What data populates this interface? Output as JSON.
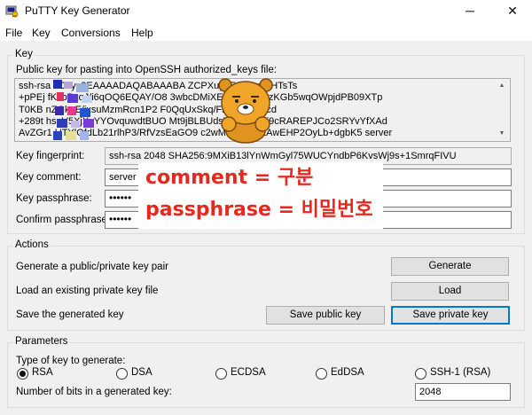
{
  "window": {
    "title": "PuTTY Key Generator",
    "minimize_glyph": "─",
    "close_glyph": "✕",
    "icon": "putty-key-icon"
  },
  "menu": [
    "File",
    "Key",
    "Conversions",
    "Help"
  ],
  "key_group": {
    "label": "Key",
    "public_key_label": "Public key for pasting into OpenSSH authorized_keys file:",
    "public_key_lines": [
      "ssh-rsa                    aC1yc2EAAAADAQABAAABA             ZCPXuyqFwU1gxLHTsTs",
      "+pPEj               fKJbPxqJ/i6qOQ6EQAY/O8                     3wbcDMiXEzNi8EClypzKGb5wqOWpjdPB09XTp",
      "T0KB               nZGkuE/jxsuMzmRcn1P2                     F0QqUxSkq/FrSatvZs8ecd",
      "+289t              hsnV5XjXxYYOvquwdtBUO                     Mt9jBLBUdsWEpEECii9cRAREPJCo2SRYvYfXAd",
      "AvZGr1               UTYlOfdLb21rlhP3/RfVzsEaGO9             c2wMFxknp0/LAwEHP2OyLb+dgbK5 server"
    ],
    "fingerprint_label": "Key fingerprint:",
    "fingerprint_value": "ssh-rsa 2048 SHA256:9MXiB13lYnWmGyl75WUCYndbP6KvsWj9s+1SmrqFIVU",
    "comment_label": "Key comment:",
    "comment_value": "server",
    "passphrase_label": "Key passphrase:",
    "passphrase_value": "••••••",
    "confirm_label": "Confirm passphrase:",
    "confirm_value": "••••••"
  },
  "actions_group": {
    "label": "Actions",
    "generate_text": "Generate a public/private key pair",
    "generate_button": "Generate",
    "load_text": "Load an existing private key file",
    "load_button": "Load",
    "save_text": "Save the generated key",
    "save_public_button": "Save public key",
    "save_private_button": "Save private key"
  },
  "parameters_group": {
    "label": "Parameters",
    "type_label": "Type of key to generate:",
    "key_types": [
      {
        "label": "RSA",
        "selected": true
      },
      {
        "label": "DSA",
        "selected": false
      },
      {
        "label": "ECDSA",
        "selected": false
      },
      {
        "label": "EdDSA",
        "selected": false
      },
      {
        "label": "SSH-1 (RSA)",
        "selected": false
      }
    ],
    "bits_label": "Number of bits in a generated key:",
    "bits_value": "2048"
  },
  "annotation": {
    "line1": "comment  =  구분",
    "line2": "passphrase  =  비밀번호",
    "color": "#e8281e"
  },
  "sticker": {
    "icon": "bear-character-sticker"
  }
}
